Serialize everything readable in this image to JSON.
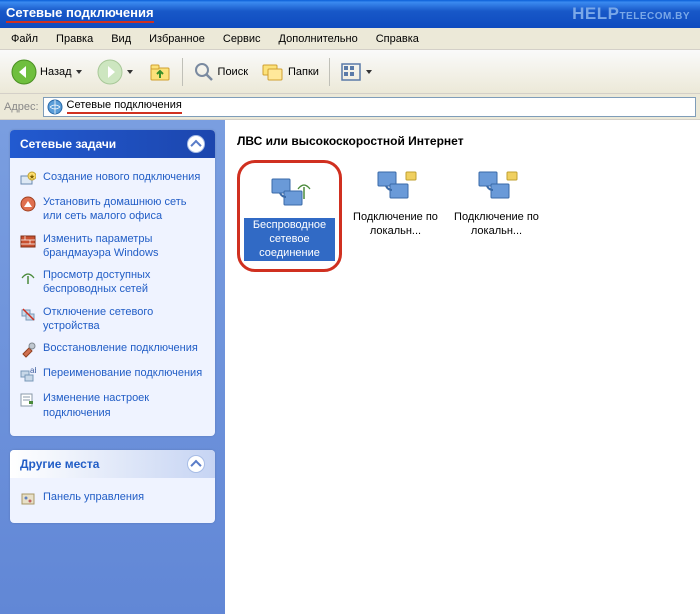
{
  "window": {
    "title": "Сетевые подключения"
  },
  "watermark": {
    "bold": "HELP",
    "rest": "TELECOM.BY"
  },
  "menu": {
    "items": [
      "Файл",
      "Правка",
      "Вид",
      "Избранное",
      "Сервис",
      "Дополнительно",
      "Справка"
    ]
  },
  "toolbar": {
    "back": "Назад",
    "search": "Поиск",
    "folders": "Папки"
  },
  "address": {
    "label": "Адрес:",
    "value": "Сетевые подключения"
  },
  "sidebar": {
    "panel1": {
      "title": "Сетевые задачи",
      "tasks": [
        "Создание нового подключения",
        "Установить домашнюю сеть или сеть малого офиса",
        "Изменить параметры брандмауэра Windows",
        "Просмотр доступных беспроводных сетей",
        "Отключение сетевого устройства",
        "Восстановление подключения",
        "Переименование подключения",
        "Изменение настроек подключения"
      ]
    },
    "panel2": {
      "title": "Другие места",
      "tasks": [
        "Панель управления"
      ]
    }
  },
  "content": {
    "section": "ЛВС или высокоскоростной Интернет",
    "items": [
      {
        "label": "Беспроводное сетевое соединение"
      },
      {
        "label": "Подключение по локальн..."
      },
      {
        "label": "Подключение по локальн..."
      }
    ]
  }
}
